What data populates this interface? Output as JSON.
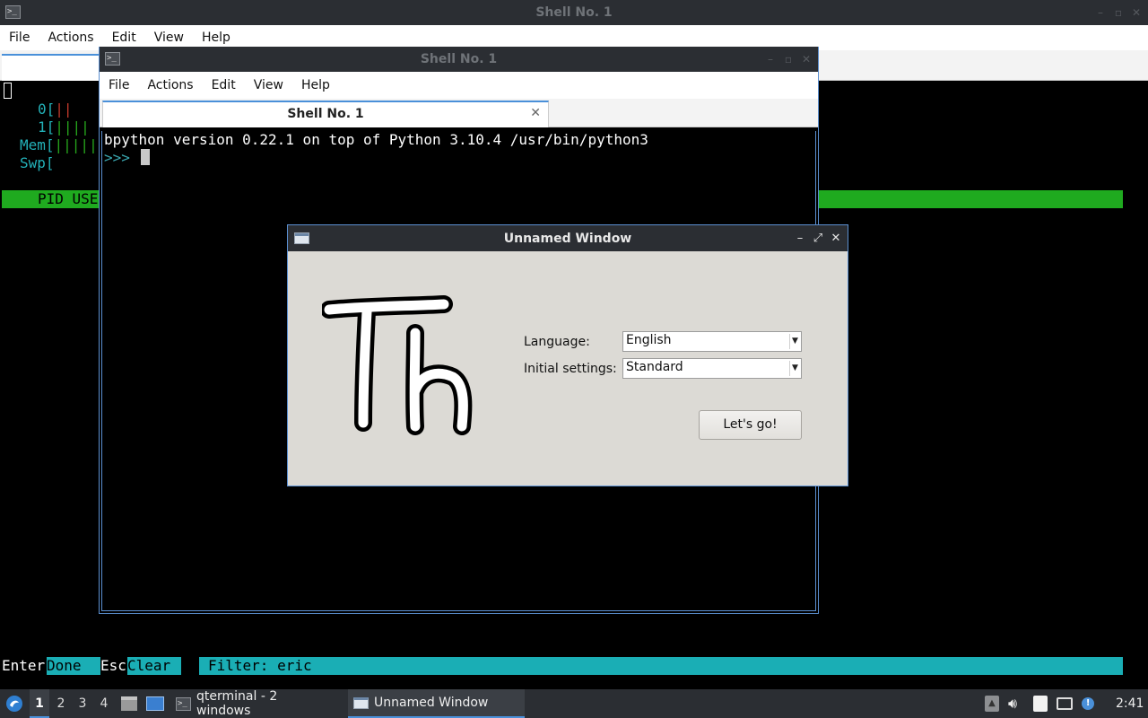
{
  "back_window": {
    "title": "Shell No. 1",
    "controls": [
      "–",
      "▫",
      "✕"
    ],
    "menu": [
      "File",
      "Actions",
      "Edit",
      "View",
      "Help"
    ],
    "htop": {
      "cpu0_label": "0[",
      "cpu0_bar": "||",
      "cpu1_label": "1[",
      "cpu1_bar": "||||",
      "mem_label": "Mem[",
      "mem_bar": "|||||",
      "swp_label": "Swp[",
      "header": "PID USE",
      "footer_key1": "Enter",
      "footer_val1": "Done  ",
      "footer_key2": "Esc",
      "footer_val2": "Clear  ",
      "footer_filter": "Filter: eric"
    }
  },
  "front_window": {
    "title": "Shell No. 1",
    "controls": [
      "–",
      "▫",
      "✕"
    ],
    "menu": [
      "File",
      "Actions",
      "Edit",
      "View",
      "Help"
    ],
    "tab_label": "Shell No. 1",
    "tab_close": "✕",
    "banner": "bpython version 0.22.1 on top of Python 3.10.4 /usr/bin/python3",
    "prompt": ">>>"
  },
  "dialog": {
    "title": "Unnamed Window",
    "controls": [
      "–",
      "⤢",
      "✕"
    ],
    "logo_text": "Th",
    "language_label": "Language:",
    "language_value": "English",
    "settings_label": "Initial settings:",
    "settings_value": "Standard",
    "go_button": "Let's go!"
  },
  "taskbar": {
    "desktops": [
      "1",
      "2",
      "3",
      "4"
    ],
    "active_desktop": "1",
    "tasks": [
      {
        "label": "qterminal - 2 windows",
        "icon": "terminal-icon"
      },
      {
        "label": "Unnamed Window",
        "icon": "window-icon"
      }
    ],
    "clock": "2:41",
    "tray_icons": [
      "update-icon",
      "volume-icon",
      "clipboard-icon",
      "network-icon",
      "notification-icon"
    ]
  },
  "colors": {
    "titlebar": "#2b2e33",
    "accent": "#4a90d9",
    "htop_green": "#1faa1f",
    "htop_cyan": "#1aaeb5"
  }
}
